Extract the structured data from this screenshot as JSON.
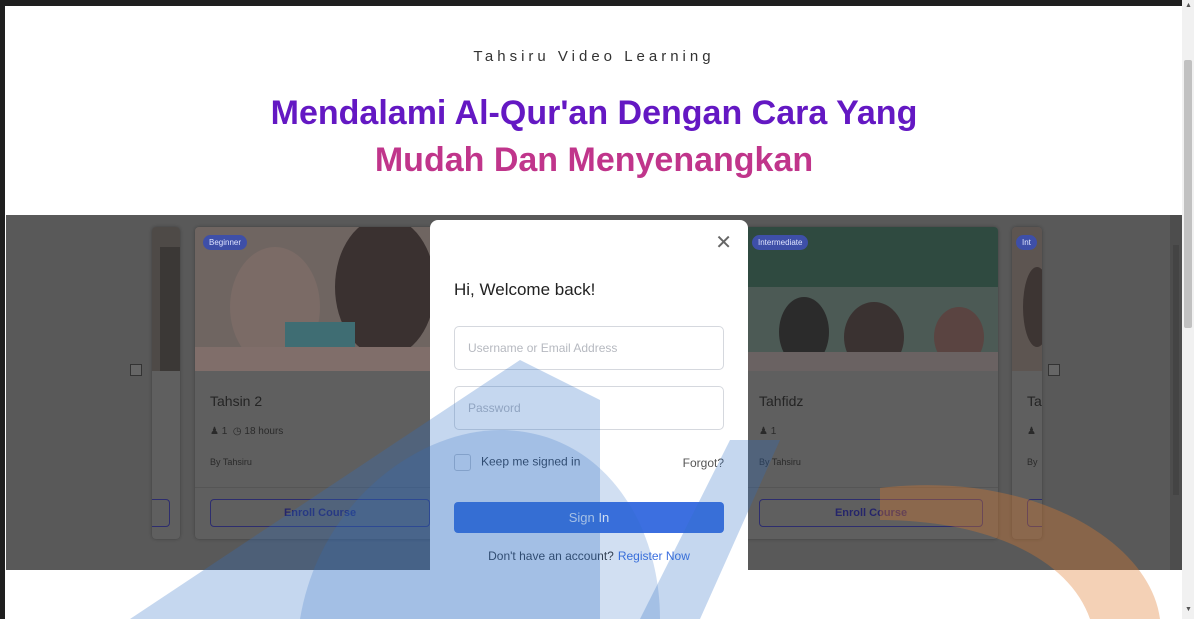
{
  "hero": {
    "eyebrow": "Tahsiru Video Learning",
    "headline_line1": "Mendalami Al-Qur'an Dengan Cara Yang",
    "headline_line2": "Mudah Dan Menyenangkan"
  },
  "courses": [
    {
      "badge": "",
      "title": "",
      "students": "",
      "duration": "",
      "author": "",
      "enroll_label": ""
    },
    {
      "badge": "Beginner",
      "title": "Tahsin 2",
      "students": "1",
      "duration": "18 hours",
      "by_label": "By",
      "author": "Tahsiru",
      "enroll_label": "Enroll Course"
    },
    {
      "badge": "Intermediate",
      "title": "Tahfidz",
      "students": "1",
      "duration": "",
      "by_label": "By",
      "author": "Tahsiru",
      "enroll_label": "Enroll Course"
    },
    {
      "badge": "Int",
      "title": "Ta",
      "students": "",
      "by_label": "By",
      "author": "",
      "enroll_label": ""
    }
  ],
  "login_modal": {
    "title": "Hi, Welcome back!",
    "username_placeholder": "Username or Email Address",
    "password_placeholder": "Password",
    "keep_signed_in": "Keep me signed in",
    "forgot": "Forgot?",
    "sign_in": "Sign In",
    "no_account": "Don't have an account?",
    "register": "Register Now",
    "close_icon": "close-icon"
  },
  "colors": {
    "headline_primary": "#6418c3",
    "headline_secondary": "#c0358b",
    "button_blue": "#3c6fe0",
    "overlay": "#595959"
  }
}
